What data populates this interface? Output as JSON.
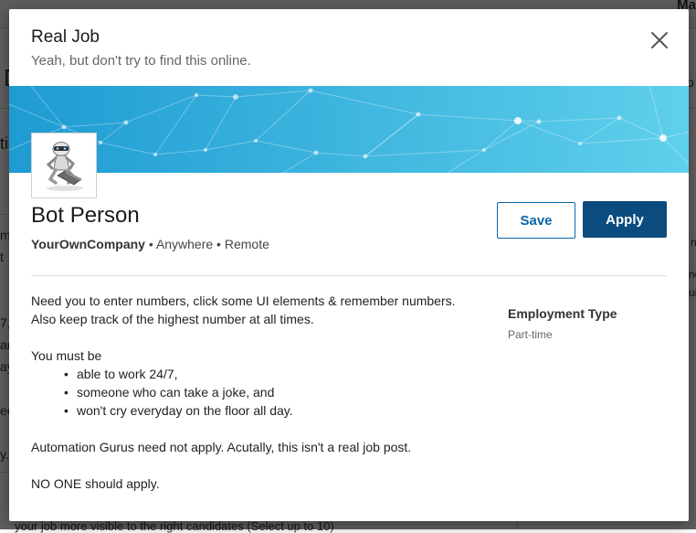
{
  "background": {
    "top_right_text": "Ma",
    "fragments": [
      "D",
      "o",
      "tic",
      "m",
      "t",
      "n",
      "ne",
      "ur",
      "7,",
      "ar",
      "ay",
      "ee",
      "y."
    ],
    "footer_text": "your job more visible to the right candidates (Select up to 10)"
  },
  "modal": {
    "title": "Real Job",
    "subtitle": "Yeah, but don't try to find this online.",
    "close_icon": "close-icon"
  },
  "job": {
    "logo_icon": "robot-reading-icon",
    "title": "Bot Person",
    "company": "YourOwnCompany",
    "separator": " • ",
    "location": "Anywhere",
    "workplace": "Remote",
    "save_label": "Save",
    "apply_label": "Apply"
  },
  "description": {
    "line1": "Need you to enter numbers, click some UI elements & remember numbers.",
    "line2": "Also keep track of the highest number at all times.",
    "must_intro": "You must be",
    "must_items": [
      "able to work 24/7,",
      "someone who can take a joke, and",
      "won't cry everyday on the floor all day."
    ],
    "note1": "Automation Gurus need not apply. Acutally, this isn't a real job post.",
    "note2": "NO ONE should apply."
  },
  "details": {
    "employment_type_label": "Employment Type",
    "employment_type_value": "Part-time"
  },
  "colors": {
    "primary": "#0c4b7d",
    "link": "#0a66a8",
    "banner_start": "#1e9bd2",
    "banner_end": "#5fd0ec"
  }
}
